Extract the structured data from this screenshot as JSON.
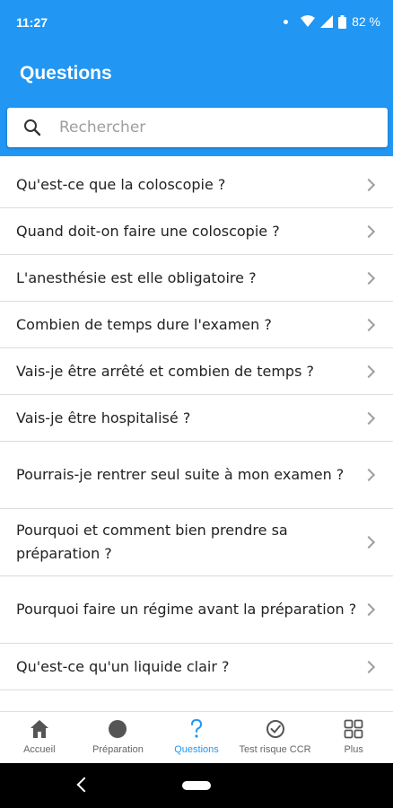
{
  "status_bar": {
    "time": "11:27",
    "battery": "82 %"
  },
  "header": {
    "title": "Questions"
  },
  "search": {
    "placeholder": "Rechercher"
  },
  "questions": [
    "Qu'est-ce que la coloscopie ?",
    "Quand doit-on faire une coloscopie ?",
    "L'anesthésie est elle obligatoire ?",
    "Combien de temps dure l'examen ?",
    "Vais-je être arrêté et combien de temps ?",
    "Vais-je être hospitalisé ?",
    "Pourrais-je rentrer seul suite à mon examen ?",
    "Pourquoi et comment bien prendre sa préparation ?",
    "Pourquoi faire un régime avant la préparation ?",
    "Qu'est-ce qu'un liquide clair ?"
  ],
  "bottom_nav": {
    "items": [
      {
        "label": "Accueil",
        "icon": "home-icon"
      },
      {
        "label": "Préparation",
        "icon": "circle-icon"
      },
      {
        "label": "Questions",
        "icon": "question-icon"
      },
      {
        "label": "Test risque CCR",
        "icon": "check-circle-icon"
      },
      {
        "label": "Plus",
        "icon": "grid-icon"
      }
    ],
    "active": "Questions"
  },
  "colors": {
    "primary": "#2196f3",
    "text": "#222222",
    "divider": "#dcdcdc"
  }
}
